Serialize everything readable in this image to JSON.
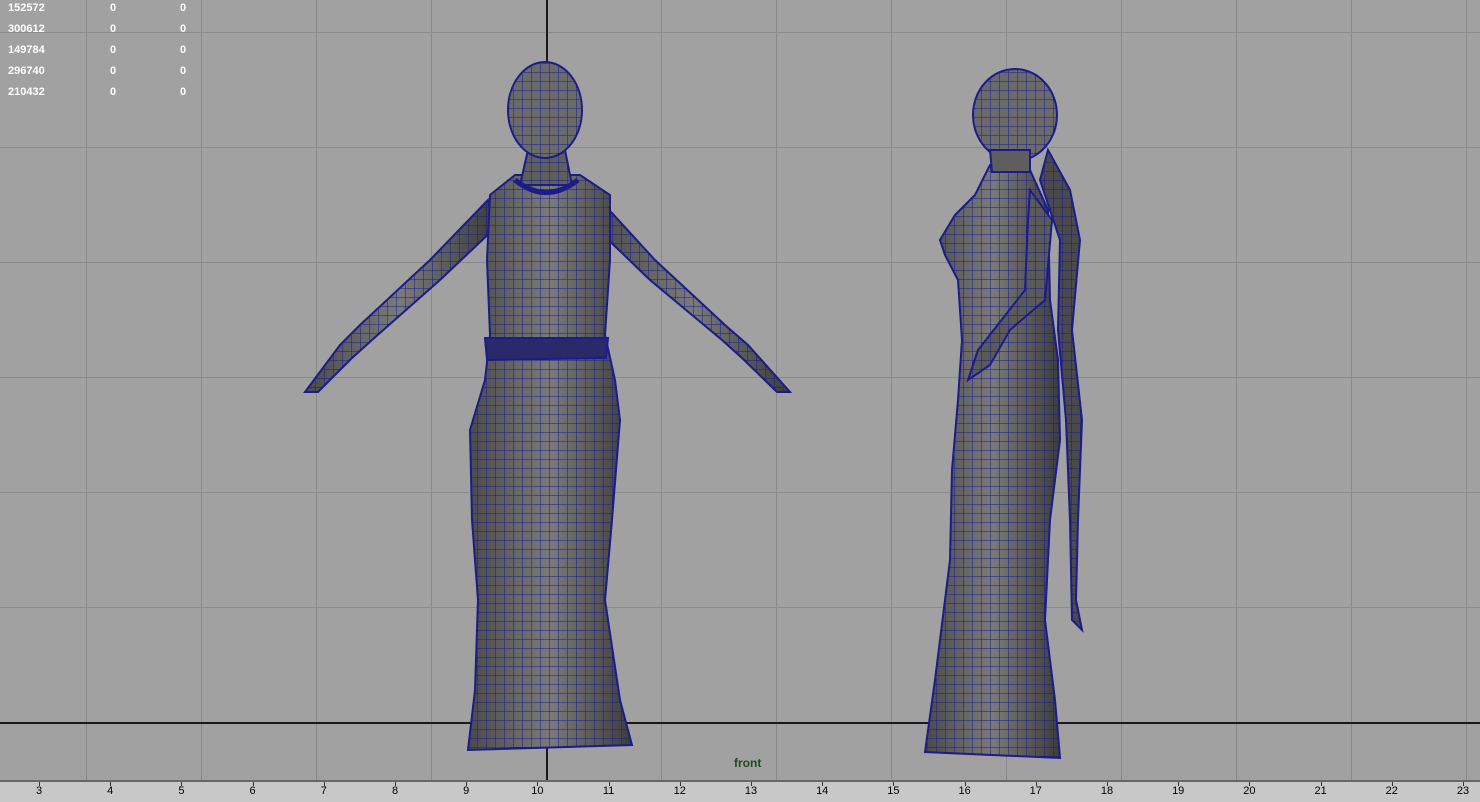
{
  "viewport": {
    "camera_label": "front",
    "background": "#a1a1a1",
    "wire_color": "#1b1b8a"
  },
  "hud": {
    "rows": [
      {
        "c1": "152572",
        "c2": "0",
        "c3": "0"
      },
      {
        "c1": "300612",
        "c2": "0",
        "c3": "0"
      },
      {
        "c1": "149784",
        "c2": "0",
        "c3": "0"
      },
      {
        "c1": "296740",
        "c2": "0",
        "c3": "0"
      },
      {
        "c1": "210432",
        "c2": "0",
        "c3": "0"
      }
    ]
  },
  "timeline": {
    "ticks": [
      "3",
      "4",
      "5",
      "6",
      "7",
      "8",
      "9",
      "10",
      "11",
      "12",
      "13",
      "14",
      "15",
      "16",
      "17",
      "18",
      "19",
      "20",
      "21",
      "22",
      "23"
    ]
  }
}
